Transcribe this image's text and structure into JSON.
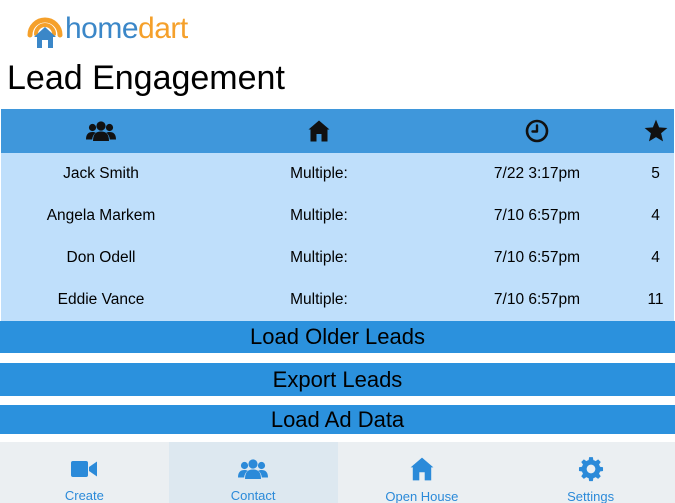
{
  "app": {
    "logo_text_part1": "home",
    "logo_text_part2": "dart",
    "brand_blue": "#3b87c8",
    "brand_orange": "#f5a02a"
  },
  "page": {
    "title": "Lead Engagement"
  },
  "table": {
    "header_icons": [
      "users-icon",
      "home-icon",
      "clock-icon",
      "star-icon"
    ],
    "header_color": "#3f97db",
    "body_color": "#bfdffb",
    "rows": [
      {
        "name": "Jack Smith",
        "property": "Multiple:",
        "time": "7/22 3:17pm",
        "score": "5"
      },
      {
        "name": "Angela Markem",
        "property": "Multiple:",
        "time": "7/10 6:57pm",
        "score": "4"
      },
      {
        "name": "Don Odell",
        "property": "Multiple:",
        "time": "7/10 6:57pm",
        "score": "4"
      },
      {
        "name": "Eddie Vance",
        "property": "Multiple:",
        "time": "7/10 6:57pm",
        "score": "11"
      }
    ]
  },
  "actions": {
    "load_older": "Load Older Leads",
    "export": "Export Leads",
    "load_ad": "Load Ad Data",
    "button_color": "#2b91dd"
  },
  "tabbar": {
    "tabs": [
      {
        "label": "Create",
        "icon": "video-camera-icon",
        "active": false
      },
      {
        "label": "Contact",
        "icon": "users-icon",
        "active": true
      },
      {
        "label": "Open House",
        "icon": "home-icon",
        "active": false
      },
      {
        "label": "Settings",
        "icon": "gear-icon",
        "active": false
      }
    ],
    "accent": "#2b8ad9"
  }
}
